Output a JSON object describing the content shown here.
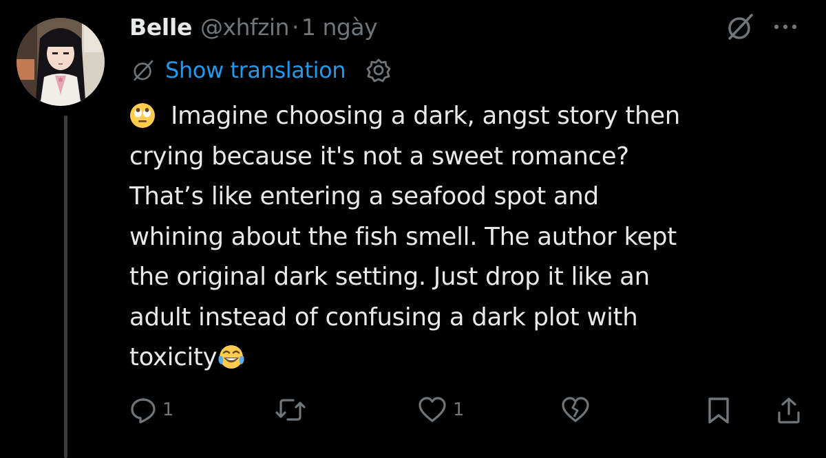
{
  "tweet": {
    "author_name": "Belle",
    "handle": "@xhfzin",
    "separator": "·",
    "time": "1 ngày",
    "translate_label": "Show translation",
    "lines": [
      "Imagine choosing a dark, angst story then",
      "crying because it's not a sweet romance?",
      "That’s like entering a seafood spot and",
      "whining about the fish smell. The author kept",
      "the original dark setting. Just drop it like an",
      "adult instead of confusing a dark plot with",
      "toxicity"
    ],
    "leading_emoji": "face-with-rolling-eyes-emoji",
    "trailing_emoji": "face-with-tears-of-joy-emoji"
  },
  "actions": {
    "reply_count": "1",
    "repost_count": "",
    "like_count": "1"
  },
  "colors": {
    "background": "#000000",
    "text": "#e7e9ea",
    "muted": "#71767b",
    "link": "#1d9bf0",
    "thread_line": "#3a3d41"
  }
}
